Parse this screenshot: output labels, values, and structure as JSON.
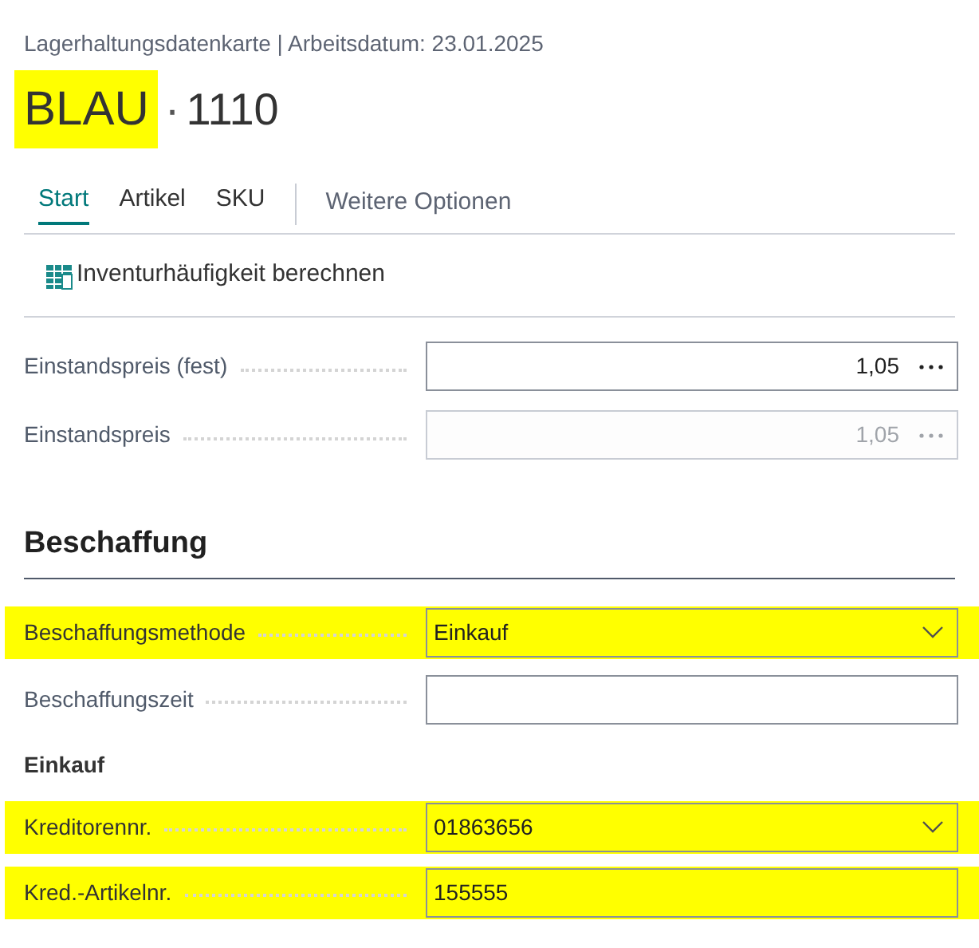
{
  "breadcrumb": "Lagerhaltungsdatenkarte | Arbeitsdatum: 23.01.2025",
  "title": {
    "name": "BLAU",
    "name_highlighted": true,
    "separator": "·",
    "number": "1110"
  },
  "tabs": [
    {
      "label": "Start",
      "selected": true
    },
    {
      "label": "Artikel",
      "selected": false
    },
    {
      "label": "SKU",
      "selected": false
    }
  ],
  "more_options": "Weitere Optionen",
  "actions": [
    {
      "label": "Inventurhäufigkeit berechnen"
    }
  ],
  "cost_fields": [
    {
      "label": "Einstandspreis (fest)",
      "kind": "number",
      "value": "1,05",
      "disabled": false,
      "highlighted": false
    },
    {
      "label": "Einstandspreis",
      "kind": "number",
      "value": "1,05",
      "disabled": true,
      "highlighted": false
    }
  ],
  "section": {
    "title": "Beschaffung",
    "fields": [
      {
        "label": "Beschaffungsmethode",
        "kind": "dropdown",
        "value": "Einkauf",
        "highlighted": true
      },
      {
        "label": "Beschaffungszeit",
        "kind": "text",
        "highlighted": false
      }
    ],
    "subsection": {
      "title": "Einkauf",
      "fields": [
        {
          "label": "Kreditorennr.",
          "kind": "dropdown",
          "value": "01863656",
          "highlighted": true
        },
        {
          "label": "Kred.-Artikelnr.",
          "kind": "text",
          "value": "155555",
          "highlighted": true
        }
      ]
    }
  }
}
